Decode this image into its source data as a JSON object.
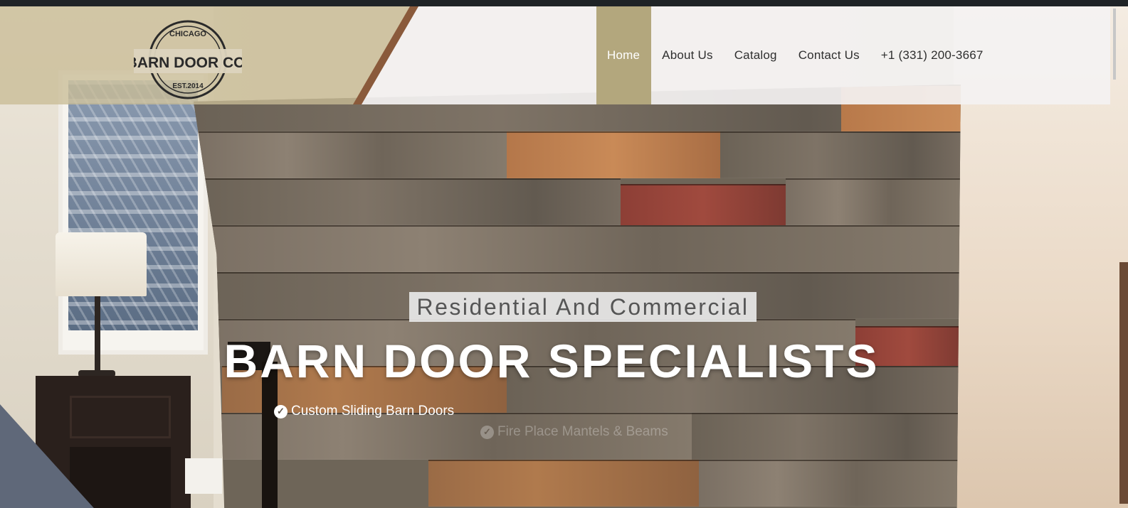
{
  "brand": {
    "logo_top": "CHICAGO",
    "logo_main": "BARN DOOR CO.",
    "logo_bottom": "EST.2014"
  },
  "nav": {
    "items": [
      {
        "label": "Home",
        "active": true
      },
      {
        "label": "About Us",
        "active": false
      },
      {
        "label": "Catalog",
        "active": false
      },
      {
        "label": "Contact Us",
        "active": false
      },
      {
        "label": "+1 (331) 200-3667",
        "active": false
      }
    ]
  },
  "hero": {
    "subtitle": "Residential And Commercial",
    "headline": "BARN DOOR SPECIALISTS",
    "features": [
      {
        "icon": "check-circle-icon",
        "label": "Custom Sliding Barn Doors"
      },
      {
        "icon": "check-circle-icon",
        "label": "Fire Place Mantels & Beams"
      }
    ]
  },
  "colors": {
    "nav_active_bg": "#b3a77d",
    "header_tan": "#c9bd96",
    "header_light": "#f4f2f2",
    "text_dark": "#2f2f2f"
  }
}
